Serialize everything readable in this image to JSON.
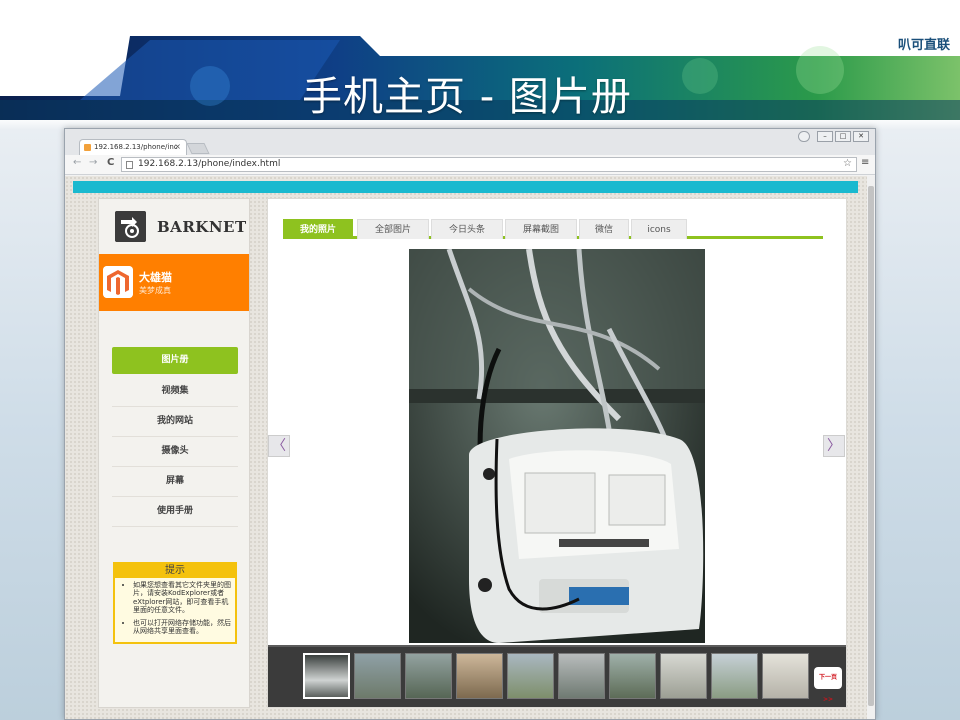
{
  "slide": {
    "brand": "叭可直联",
    "title": "手机主页 - 图片册"
  },
  "browser": {
    "tab_title": "192.168.2.13/phone/inc",
    "tab_close": "×",
    "url": "192.168.2.13/phone/index.html",
    "menu_glyph": "≡",
    "star_glyph": "☆"
  },
  "sidebar": {
    "logo_text": "BARKNET",
    "profile_name": "大雄猫",
    "profile_subtitle": "美梦成真",
    "nav_items": [
      {
        "label": "图片册",
        "active": true
      },
      {
        "label": "视频集",
        "active": false
      },
      {
        "label": "我的网站",
        "active": false
      },
      {
        "label": "摄像头",
        "active": false
      },
      {
        "label": "屏幕",
        "active": false
      },
      {
        "label": "使用手册",
        "active": false
      }
    ],
    "tip": {
      "title": "提示",
      "items": [
        "如果您想查看其它文件夹里的图片，请安装KodExplorer或者eXtplorer网站，即可查看手机里面的任意文件。",
        "也可以打开网络存储功能，然后从网络共享里面查看。"
      ]
    }
  },
  "gallery": {
    "tabs": [
      "我的照片",
      "全部图片",
      "今日头条",
      "屏幕截图",
      "微信",
      "icons"
    ],
    "active_tab": 0,
    "prev_glyph": "〈",
    "next_glyph": "〉",
    "next_page_label": "下一页 >>",
    "thumbnail_count": 10,
    "selected_thumbnail": 0
  },
  "colors": {
    "accent_green": "#8ec21f",
    "profile_orange": "#ff7f00",
    "header_cyan": "#1ab9cf",
    "tip_yellow": "#f4c20d"
  }
}
